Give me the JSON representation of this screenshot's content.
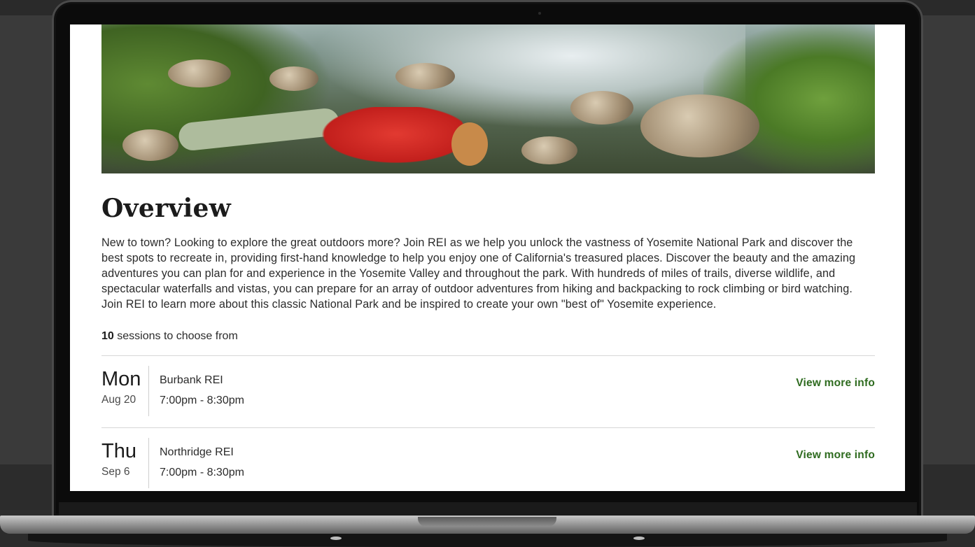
{
  "page": {
    "title": "Overview",
    "description": "New to town? Looking to explore the great outdoors more? Join REI as we help you unlock the vastness of Yosemite National Park and discover the best spots to recreate in, providing first-hand knowledge to help you enjoy one of California's treasured places. Discover the beauty and the amazing adventures you can plan for and experience in the Yosemite Valley and throughout the park. With hundreds of miles of trails, diverse wildlife, and spectacular waterfalls and vistas, you can prepare for an array of outdoor adventures from hiking and backpacking to rock climbing or bird watching. Join REI to learn more about this classic National Park and be inspired to create your own \"best of\" Yosemite experience.",
    "sessions_count": "10",
    "sessions_suffix": "sessions to choose from"
  },
  "sessions": [
    {
      "day": "Mon",
      "date": "Aug 20",
      "location": "Burbank REI",
      "time": "7:00pm - 8:30pm",
      "link_label": "View more info"
    },
    {
      "day": "Thu",
      "date": "Sep 6",
      "location": "Northridge REI",
      "time": "7:00pm - 8:30pm",
      "link_label": "View more info"
    }
  ],
  "colors": {
    "link": "#2e6b1f",
    "text": "#2b2b2b",
    "heading": "#1b1b1b"
  }
}
